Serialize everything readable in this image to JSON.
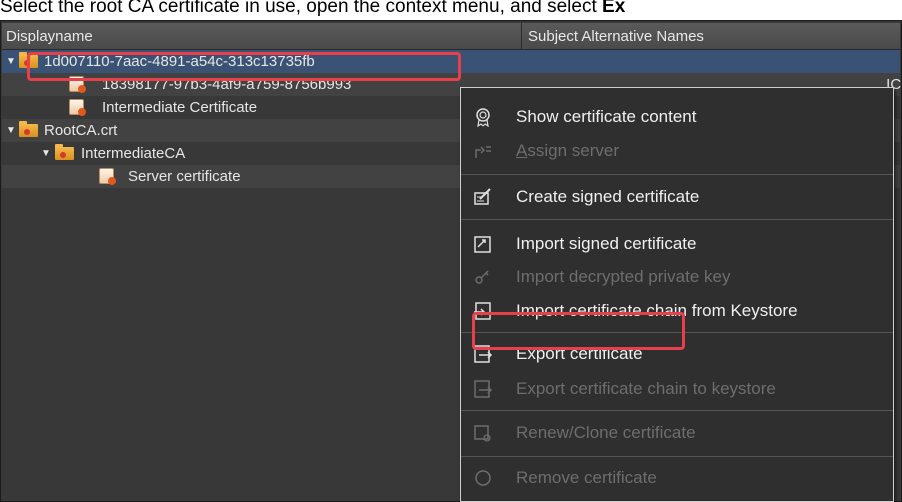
{
  "instruction": {
    "prefix": "Select the root CA certificate in use, open the context menu, and select",
    "suffix": "Ex"
  },
  "columns": [
    "Displayname",
    "Subject Alternative Names"
  ],
  "tree": [
    {
      "label": "1d007110-7aac-4891-a54c-313c13735fb",
      "type": "folder",
      "level": 0,
      "expanded": true,
      "selected": true
    },
    {
      "label": "18398177-97b3-4af9-a759-8756b993",
      "type": "cert",
      "level": 1,
      "san": ".IC"
    },
    {
      "label": "Intermediate Certificate",
      "type": "cert",
      "level": 1
    },
    {
      "label": "RootCA.crt",
      "type": "folder",
      "level": 0,
      "expanded": true
    },
    {
      "label": "IntermediateCA",
      "type": "folder",
      "level": 1,
      "expanded": true
    },
    {
      "label": "Server certificate",
      "type": "cert",
      "level": 2
    }
  ],
  "context_menu": {
    "items": [
      {
        "label": "Show certificate content",
        "icon": "certificate-seal-icon",
        "enabled": true
      },
      {
        "label": "Assign server",
        "icon": "assign-server-icon",
        "enabled": false,
        "mnemonic": "A"
      },
      {
        "label": "Create signed certificate",
        "icon": "create-signed-icon",
        "enabled": true
      },
      {
        "label": "Import signed certificate",
        "icon": "import-signed-icon",
        "enabled": true
      },
      {
        "label": "Import decrypted private key",
        "icon": "import-key-icon",
        "enabled": false
      },
      {
        "label": "Import certificate chain from Keystore",
        "icon": "import-chain-icon",
        "enabled": true
      },
      {
        "label": "Export certificate",
        "icon": "export-certificate-icon",
        "enabled": true,
        "highlighted": true
      },
      {
        "label": "Export certificate chain to keystore",
        "icon": "export-chain-icon",
        "enabled": false
      },
      {
        "label": "Renew/Clone certificate",
        "icon": "renew-icon",
        "enabled": false
      },
      {
        "label": "Remove certificate",
        "icon": "remove-icon",
        "enabled": false
      }
    ]
  },
  "colors": {
    "highlight_red": "#e8404a",
    "app_background": "#383838",
    "menu_background": "#2f2f2f",
    "disabled_text": "#6d6d6d"
  }
}
